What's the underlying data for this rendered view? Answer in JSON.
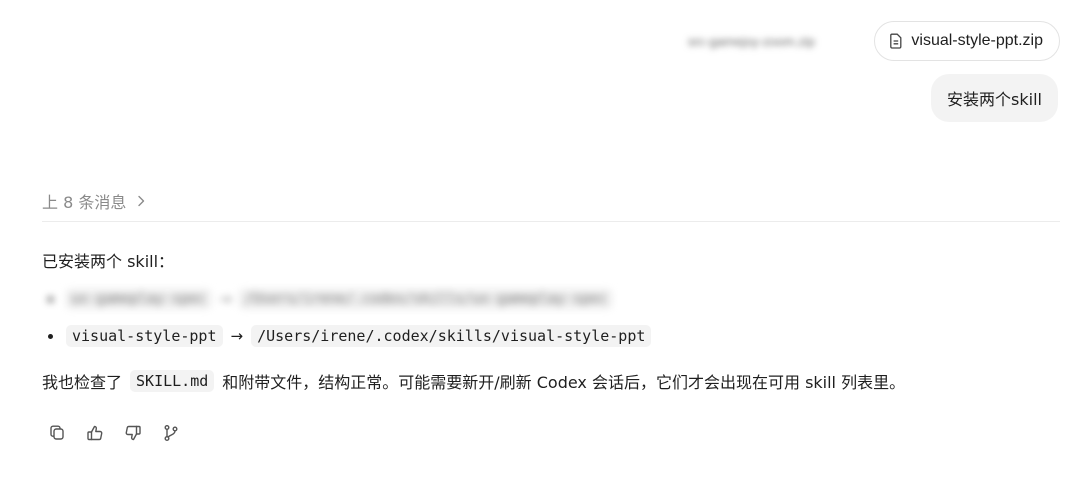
{
  "attachments": {
    "blurred_label": "src-gamejoy-zoom.zip",
    "file_name": "visual-style-ppt.zip",
    "file_icon": "document-icon"
  },
  "user_message": "安装两个skill",
  "earlier": {
    "label": "上 8 条消息",
    "icon": "chevron-right-icon"
  },
  "assistant": {
    "heading": "已安装两个 skill：",
    "blurred_item": {
      "name": "ux-gameplay-spec",
      "arrow": "→",
      "path": "/Users/irene/.codex/skills/ux-gameplay-spec"
    },
    "item": {
      "name": "visual-style-ppt",
      "arrow": "→",
      "path": "/Users/irene/.codex/skills/visual-style-ppt"
    },
    "summary_before": "我也检查了",
    "summary_code": "SKILL.md",
    "summary_after": "和附带文件，结构正常。可能需要新开/刷新 Codex 会话后，它们才会出现在可用 skill 列表里。"
  },
  "actions": [
    {
      "icon": "copy-icon"
    },
    {
      "icon": "thumbs-up-icon"
    },
    {
      "icon": "thumbs-down-icon"
    },
    {
      "icon": "branch-icon"
    }
  ],
  "colors": {
    "text": "#1f1f1f",
    "muted": "#8a8a8a",
    "bubble": "#f3f3f3",
    "border": "#e3e3e3"
  }
}
